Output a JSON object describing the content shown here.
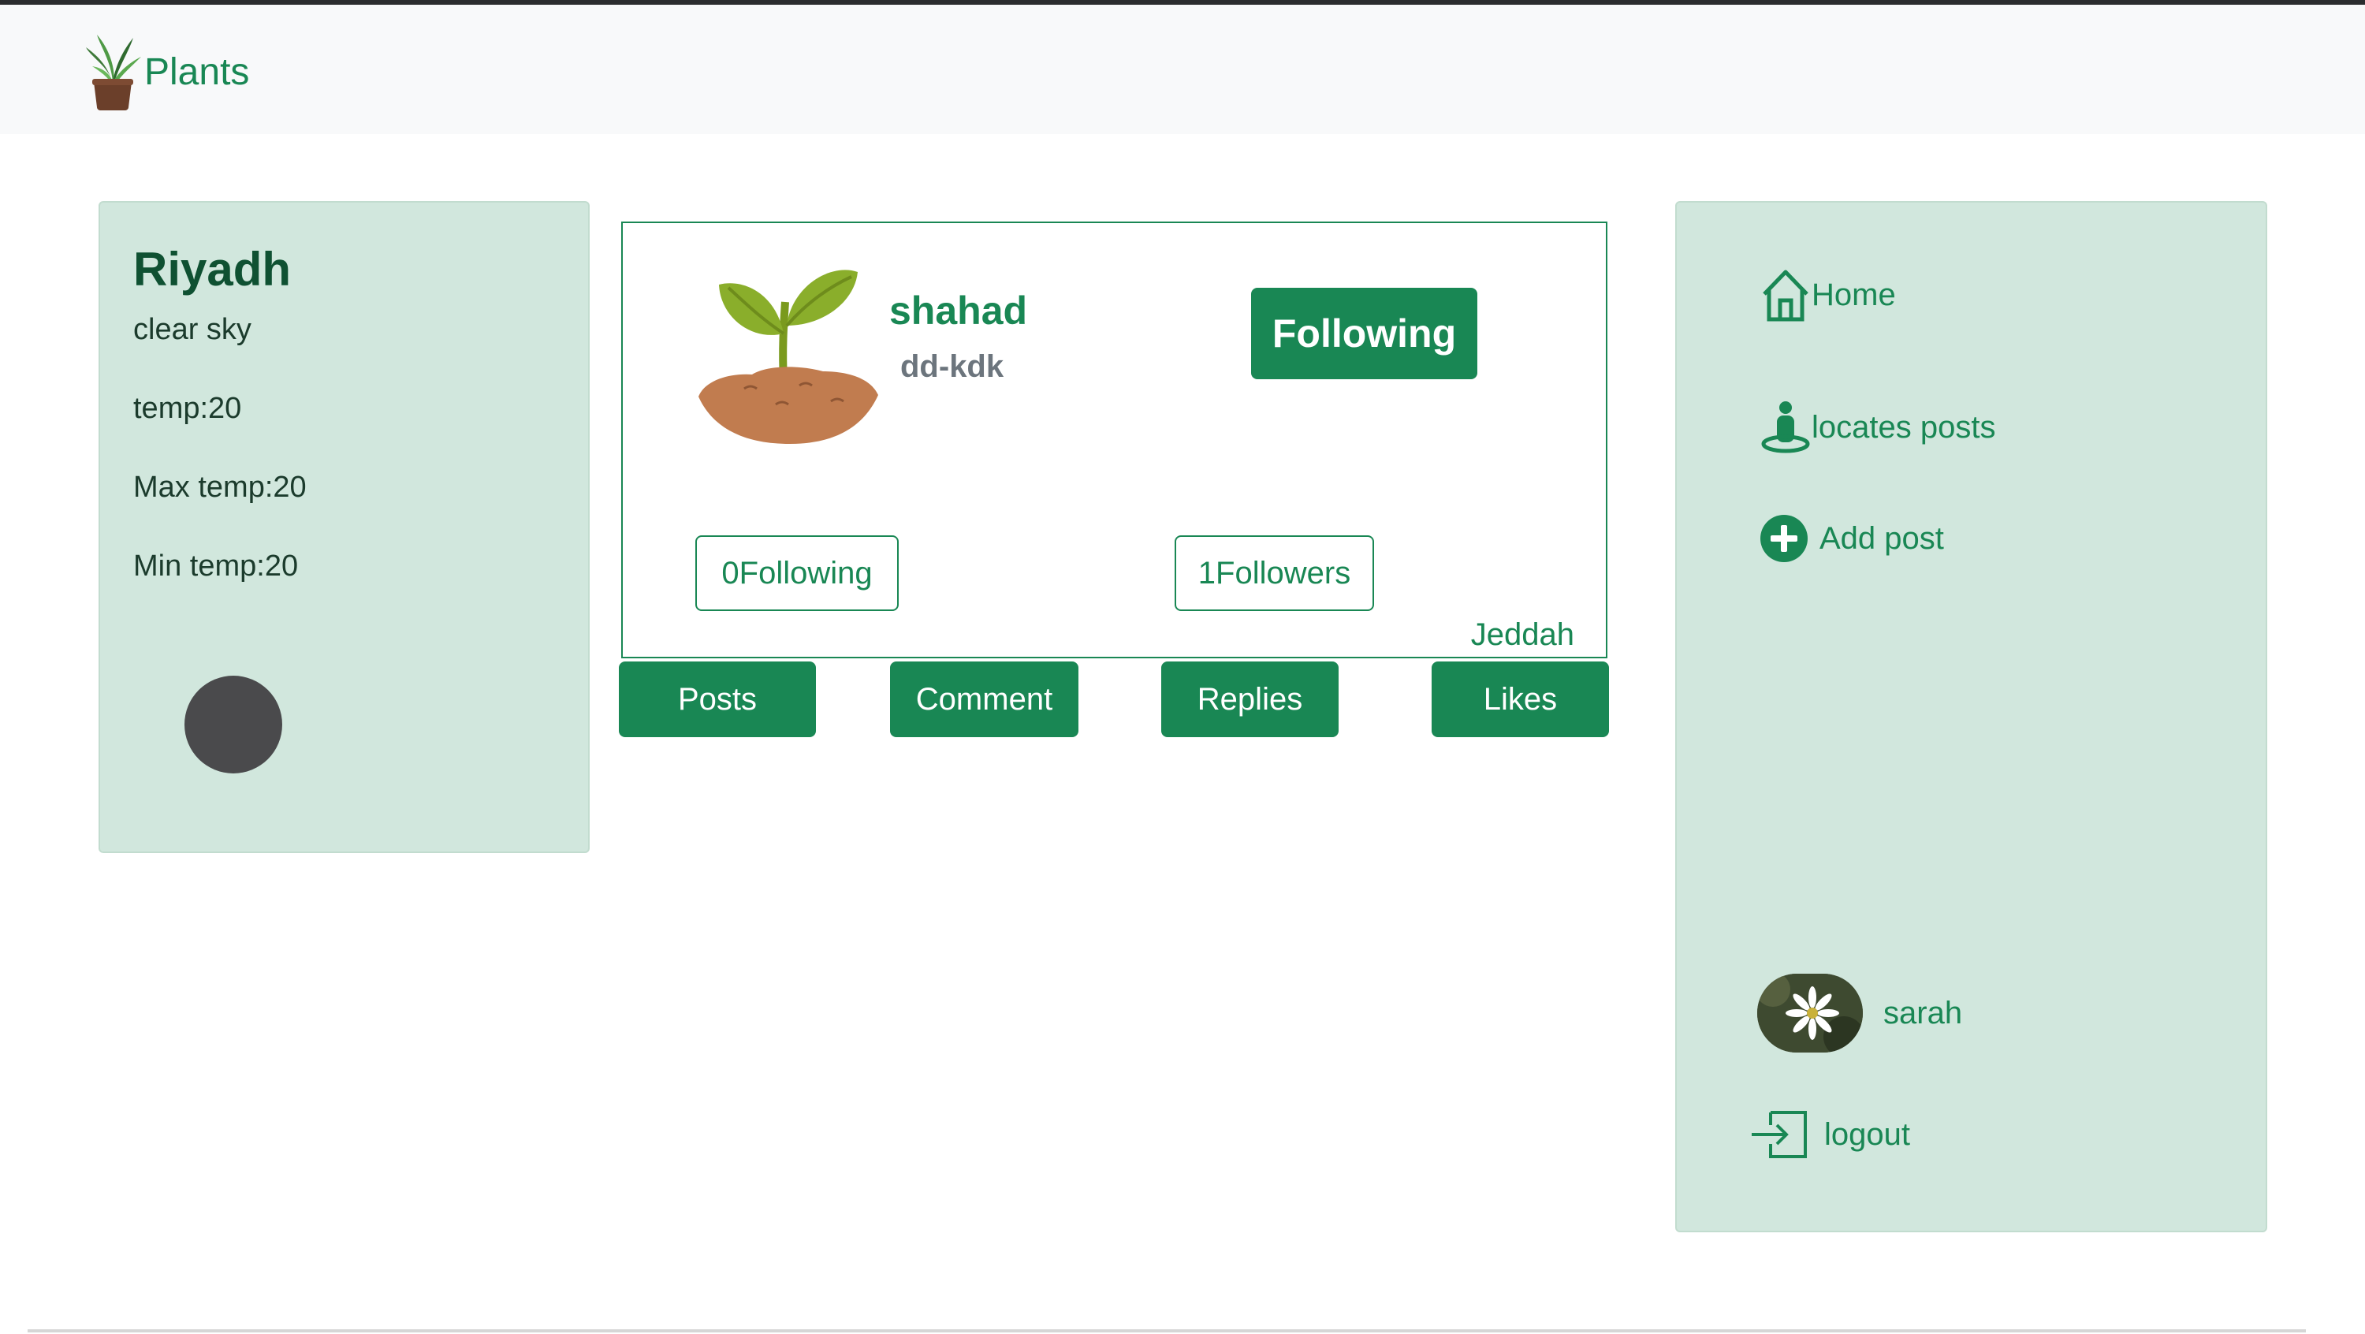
{
  "brand": {
    "name": "Plants"
  },
  "weather": {
    "city": "Riyadh",
    "description": "clear sky",
    "temp": "temp:20",
    "max_temp": "Max temp:20",
    "min_temp": "Min temp:20",
    "icon": "weather-icon"
  },
  "profile": {
    "name": "shahad",
    "handle": "dd-kdk",
    "follow_label": "Following",
    "following_count": "0Following",
    "followers_count": "1Followers",
    "city": "Jeddah"
  },
  "tabs": [
    {
      "label": "Posts"
    },
    {
      "label": "Comment"
    },
    {
      "label": "Replies"
    },
    {
      "label": "Likes"
    }
  ],
  "sidebar": {
    "items": [
      {
        "label": "Home",
        "icon": "home-icon"
      },
      {
        "label": "locates posts",
        "icon": "person-location-icon"
      },
      {
        "label": "Add post",
        "icon": "plus-circle-icon"
      }
    ],
    "user": {
      "name": "sarah"
    },
    "logout_label": "logout"
  },
  "colors": {
    "accent": "#198754",
    "card_bg": "#d1e7dd",
    "navbar_bg": "#f8f9fa"
  }
}
